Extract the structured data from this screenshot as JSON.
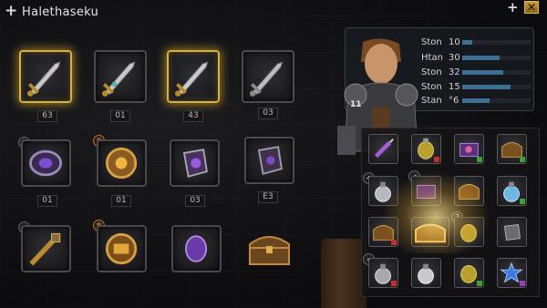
{
  "header": {
    "title": "Halethaseku",
    "add_icon": "+",
    "add_icon_right": "+",
    "close_icon": "✕",
    "colors": {
      "accent_gold": "#d8b23a",
      "close_bg": "#c79a38"
    }
  },
  "stash": {
    "row1": [
      {
        "icon": "sword-icon",
        "count": "63",
        "glow": true
      },
      {
        "icon": "sword-icon",
        "count": "01",
        "glow": false
      },
      {
        "icon": "sword-icon",
        "count": "43",
        "glow": true
      },
      {
        "icon": "sword-icon",
        "count": "03",
        "glow": false
      }
    ],
    "row2": [
      {
        "icon": "bracer-icon",
        "count": "01",
        "badge": "◂"
      },
      {
        "icon": "orb-armor-icon",
        "count": "01",
        "badge": "♆"
      },
      {
        "icon": "gauntlet-icon",
        "count": "03",
        "badge": ""
      },
      {
        "icon": "gauntlet-icon",
        "count": "E3",
        "badge": ""
      }
    ],
    "row3": [
      {
        "icon": "mace-icon",
        "badge": "◂"
      },
      {
        "icon": "orb-armor-icon",
        "badge": "♆"
      },
      {
        "icon": "gem-icon",
        "badge": ""
      },
      {
        "icon": "chest-icon",
        "badge": ""
      }
    ]
  },
  "character": {
    "level": "11",
    "stats": [
      {
        "label": "Ston",
        "value": "10",
        "fill": 0.15
      },
      {
        "label": "Htan",
        "value": "30",
        "fill": 0.55
      },
      {
        "label": "Ston",
        "value": "32",
        "fill": 0.6
      },
      {
        "label": "Ston",
        "value": "15",
        "fill": 0.7
      },
      {
        "label": "Stan",
        "value": "°6",
        "fill": 0.4
      }
    ]
  },
  "inventory": {
    "badges": {
      "r2": "+",
      "r2b": "◂",
      "r3": "2",
      "r4": "◂"
    },
    "items": [
      [
        "syringe-icon",
        "lantern-icon",
        "purple-chest-icon",
        "chest-icon"
      ],
      [
        "potion-icon",
        "purple-chest-icon",
        "chest-icon",
        "blue-potion-icon"
      ],
      [
        "chest-icon",
        "gold-chest-icon",
        "lantern-icon",
        "gauntlet-icon"
      ],
      [
        "potion-icon",
        "potion-icon",
        "lantern-icon",
        "star-icon"
      ]
    ]
  }
}
